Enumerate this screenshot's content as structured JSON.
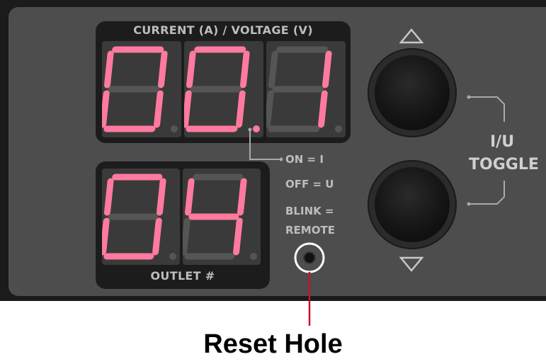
{
  "display": {
    "top_label": "CURRENT (A) / VOLTAGE (V)",
    "top_value": "00.1",
    "bottom_label": "OUTLET #",
    "bottom_value": "04"
  },
  "legend": {
    "on": "ON = I",
    "off": "OFF = U",
    "blink": "BLINK =",
    "remote": "REMOTE"
  },
  "toggle": {
    "label_line1": "I/U",
    "label_line2": "TOGGLE"
  },
  "annotation": {
    "caption": "Reset Hole",
    "color": "#c8102e"
  },
  "colors": {
    "segment_on": "#ff7a9e",
    "segment_off": "#555555"
  },
  "icons": {
    "up": "triangle-up-icon",
    "down": "triangle-down-icon"
  }
}
